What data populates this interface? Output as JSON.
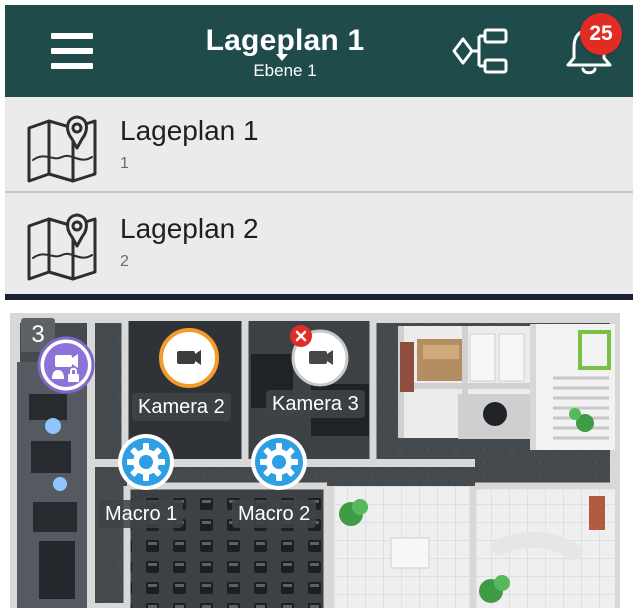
{
  "header": {
    "title": "Lageplan 1",
    "subtitle": "Ebene 1",
    "notification_count": "25",
    "background_color": "#1f4b4a",
    "badge_color": "#e22b25",
    "menu_icon": "hamburger-menu-icon",
    "hierarchy_icon": "hierarchy-tree-icon",
    "notification_icon": "bell-icon"
  },
  "plans": [
    {
      "title": "Lageplan 1",
      "subtitle": "1",
      "icon": "map-pin-icon"
    },
    {
      "title": "Lageplan 2",
      "subtitle": "2",
      "icon": "map-pin-icon"
    }
  ],
  "floor_plan": {
    "level": "3",
    "markers": [
      {
        "type": "alarm-camera",
        "icon": "camera-alarm-lock-icon",
        "label": ""
      },
      {
        "type": "camera",
        "label": "Kamera 2",
        "icon": "camera-icon",
        "status": "selected",
        "ring_color": "#f59a2b"
      },
      {
        "type": "camera",
        "label": "Kamera 3",
        "icon": "camera-icon",
        "status": "error",
        "error_color": "#e22b25"
      },
      {
        "type": "macro",
        "label": "Macro 1",
        "icon": "gear-icon",
        "color": "#2d9fe2"
      },
      {
        "type": "macro",
        "label": "Macro 2",
        "icon": "gear-icon",
        "color": "#2d9fe2"
      }
    ]
  }
}
